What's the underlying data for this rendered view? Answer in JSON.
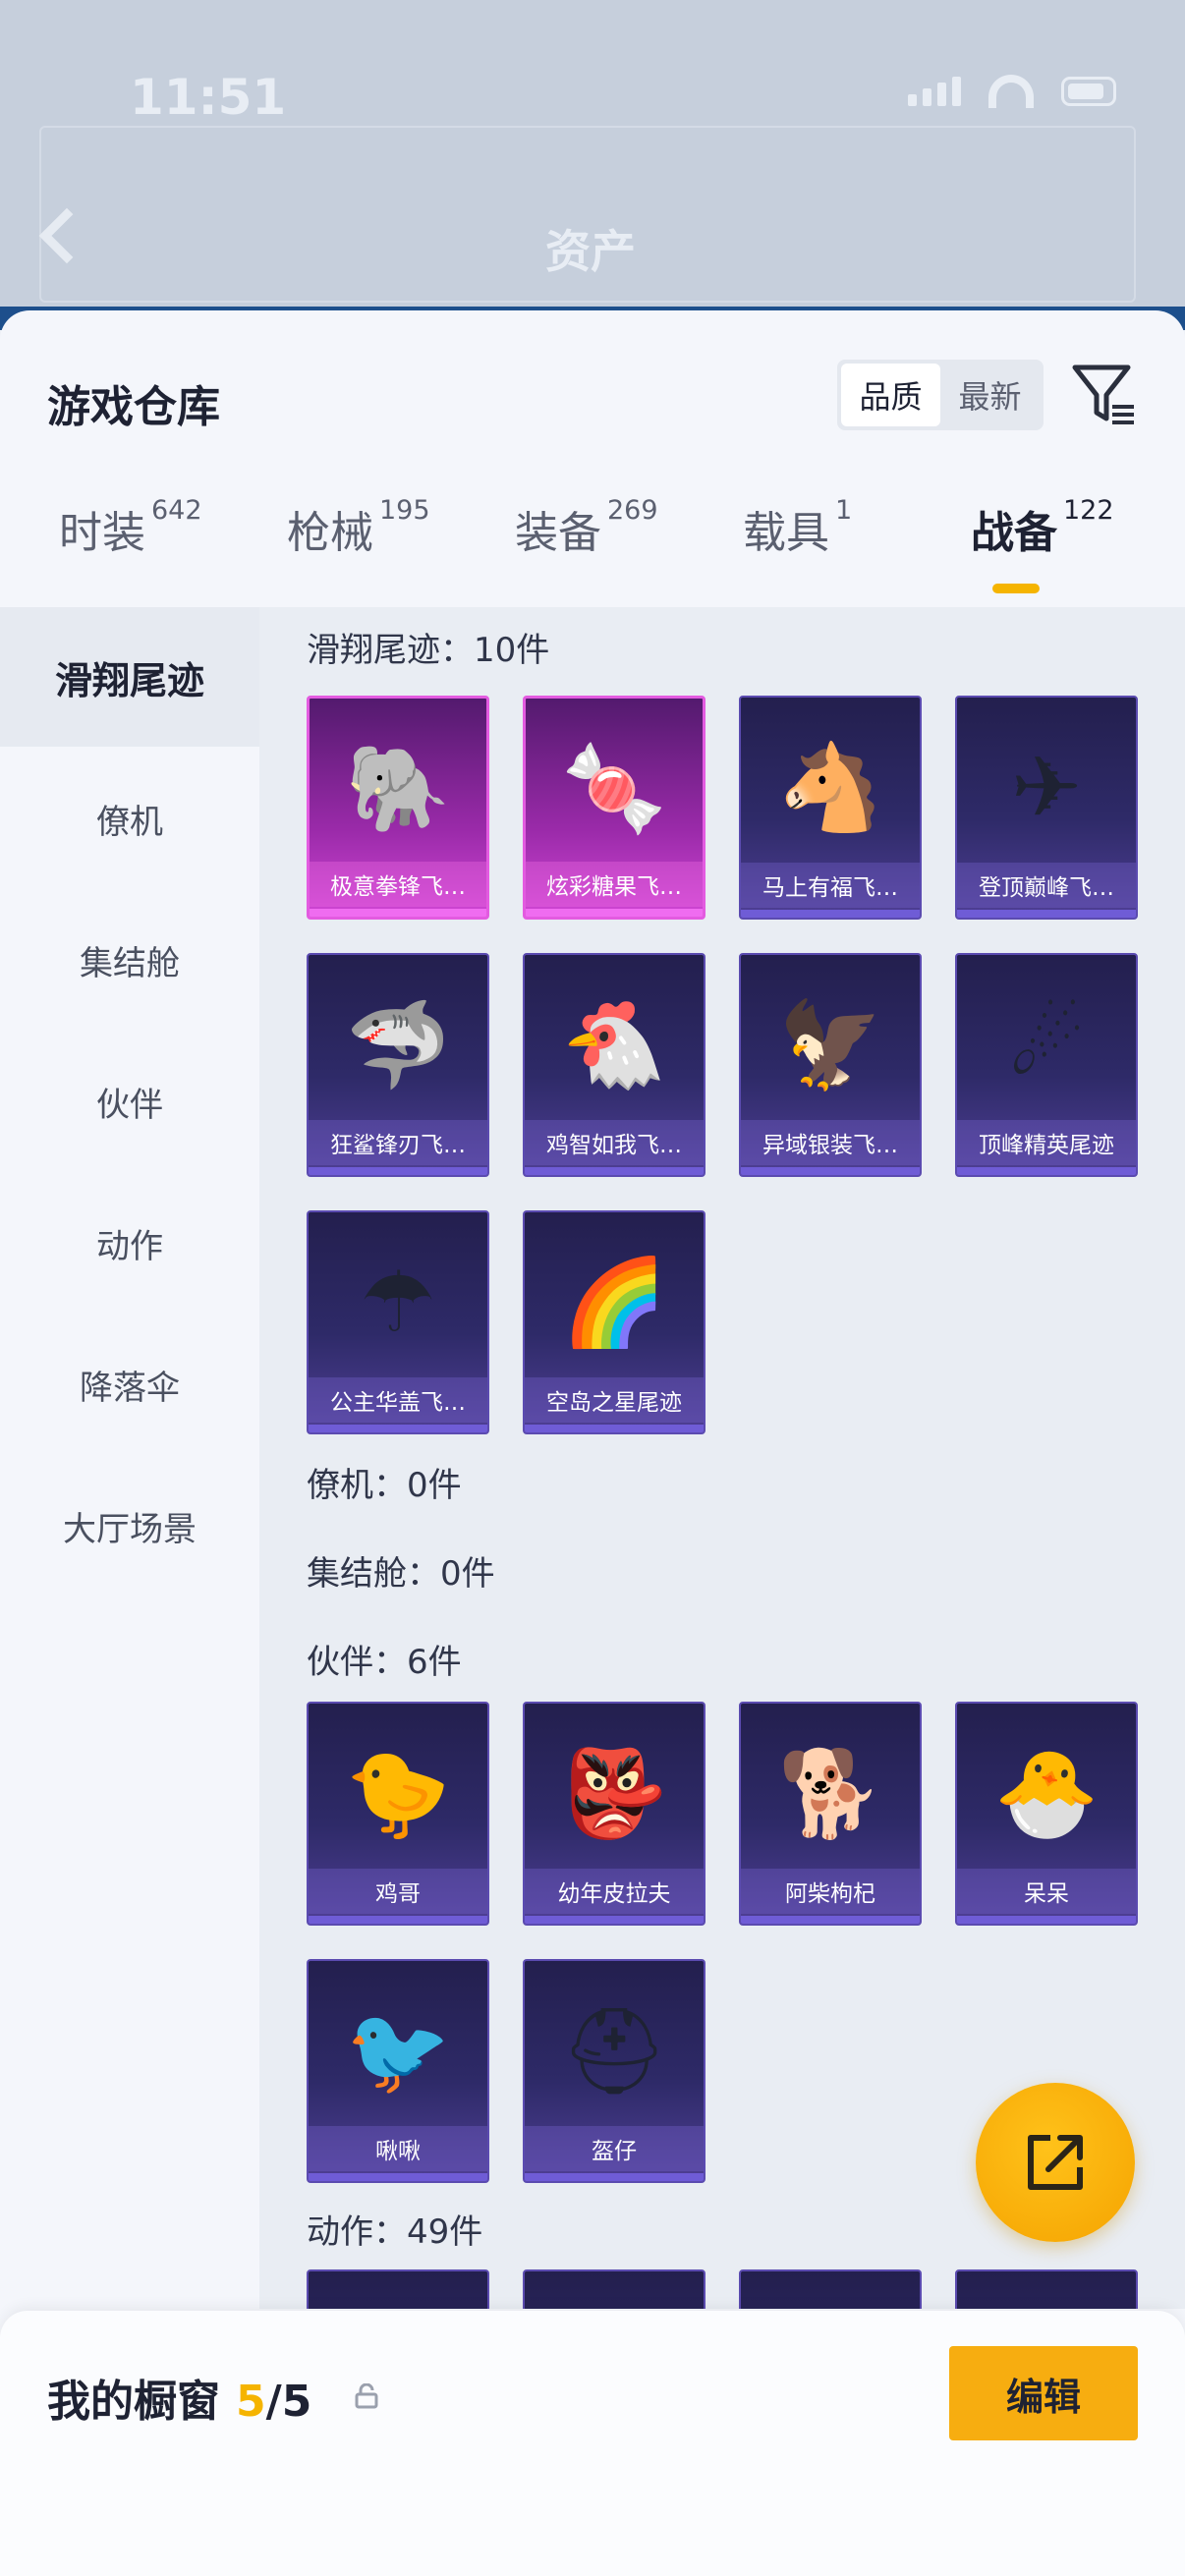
{
  "status_bar": {
    "time": "11:51",
    "time_icon": "paw-icon"
  },
  "background": {
    "title": "资产"
  },
  "sheet": {
    "title": "游戏仓库",
    "sort": {
      "options": [
        "品质",
        "最新"
      ],
      "selected": "品质"
    },
    "tabs": [
      {
        "label": "时装",
        "count": "642"
      },
      {
        "label": "枪械",
        "count": "195"
      },
      {
        "label": "装备",
        "count": "269"
      },
      {
        "label": "载具",
        "count": "1"
      },
      {
        "label": "战备",
        "count": "122",
        "active": true
      }
    ]
  },
  "sidebar": {
    "items": [
      {
        "label": "滑翔尾迹",
        "active": true
      },
      {
        "label": "僚机"
      },
      {
        "label": "集结舱"
      },
      {
        "label": "伙伴"
      },
      {
        "label": "动作"
      },
      {
        "label": "降落伞"
      },
      {
        "label": "大厅场景"
      }
    ]
  },
  "sections": {
    "glide": {
      "header": "滑翔尾迹：10件",
      "items": [
        {
          "name": "极意拳锋飞…",
          "rarity": "pink",
          "icon": "elephant-icon"
        },
        {
          "name": "炫彩糖果飞…",
          "rarity": "pink",
          "icon": "candy-icon"
        },
        {
          "name": "马上有福飞…",
          "rarity": "purple",
          "icon": "horse-icon"
        },
        {
          "name": "登顶巅峰飞…",
          "rarity": "purple",
          "icon": "jet-icon"
        },
        {
          "name": "狂鲨锋刃飞…",
          "rarity": "purple",
          "icon": "shark-icon"
        },
        {
          "name": "鸡智如我飞…",
          "rarity": "purple",
          "icon": "chicken-icon"
        },
        {
          "name": "异域银装飞…",
          "rarity": "purple",
          "icon": "wing-icon"
        },
        {
          "name": "顶峰精英尾迹",
          "rarity": "purple",
          "icon": "trail-icon"
        },
        {
          "name": "公主华盖飞…",
          "rarity": "purple",
          "icon": "canopy-icon"
        },
        {
          "name": "空岛之星尾迹",
          "rarity": "purple",
          "icon": "rainbow-trail-icon"
        }
      ]
    },
    "wingman": {
      "header": "僚机：0件"
    },
    "pod": {
      "header": "集结舱：0件"
    },
    "partner": {
      "header": "伙伴：6件",
      "items": [
        {
          "name": "鸡哥",
          "icon": "chicken-icon"
        },
        {
          "name": "幼年皮拉夫",
          "icon": "goblin-icon"
        },
        {
          "name": "阿柴枸杞",
          "icon": "shiba-icon"
        },
        {
          "name": "呆呆",
          "icon": "chick-icon"
        },
        {
          "name": "啾啾",
          "icon": "pink-bird-icon"
        },
        {
          "name": "盔仔",
          "icon": "helmet-chick-icon"
        }
      ]
    },
    "emote": {
      "header": "动作：49件"
    }
  },
  "bottom_bar": {
    "label": "我的橱窗",
    "count": "5",
    "total": "/5",
    "edit": "编辑"
  },
  "colors": {
    "accent": "#f5b400",
    "edit_button": "#f7ad10",
    "pink_rarity": "#e35be0",
    "purple_rarity": "#5b4bb0"
  }
}
